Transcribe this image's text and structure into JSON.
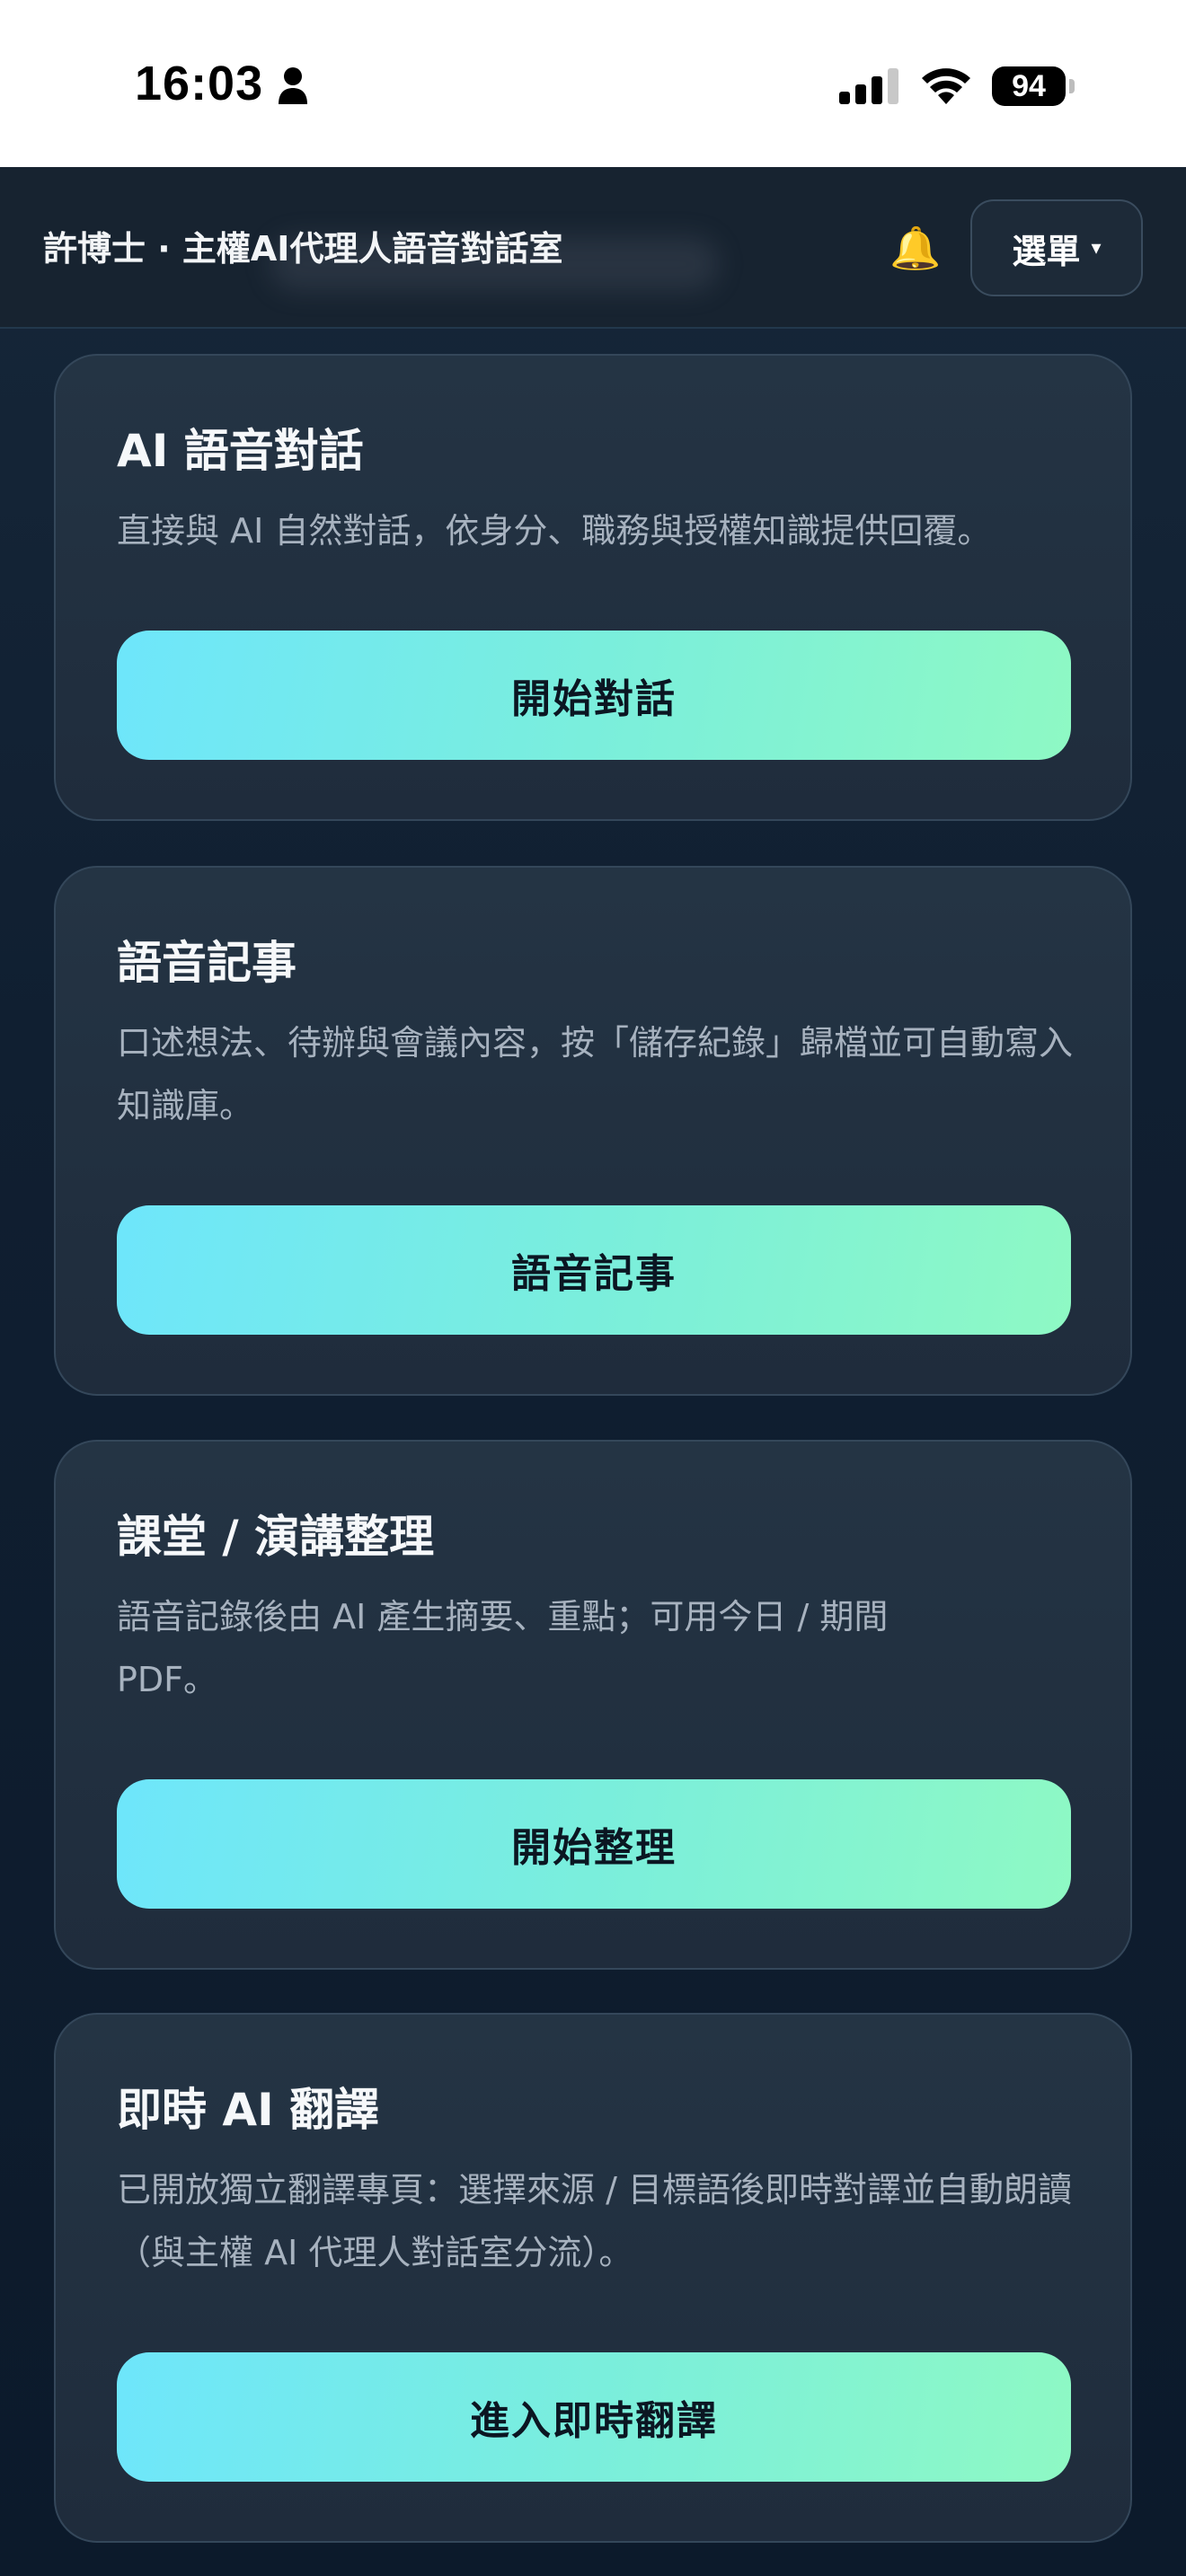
{
  "status_bar": {
    "time": "16:03",
    "battery": "94"
  },
  "header": {
    "title": "許博士 · 主權AI代理人語音對話室",
    "menu_label": "選單",
    "menu_caret": "▾"
  },
  "icons": {
    "bell": "🔔"
  },
  "cards": [
    {
      "title": "AI 語音對話",
      "description": "直接與 AI 自然對話，依身分、職務與授權知識提供回覆。",
      "button": "開始對話"
    },
    {
      "title": "語音記事",
      "description": "口述想法、待辦與會議內容，按「儲存紀錄」歸檔並可自動寫入知識庫。",
      "button": "語音記事"
    },
    {
      "title": "課堂 / 演講整理",
      "description": "語音記錄後由 AI 產生摘要、重點；可用今日 / 期間 PDF。",
      "button": "開始整理"
    },
    {
      "title": "即時 AI 翻譯",
      "description": "已開放獨立翻譯專頁：選擇來源 / 目標語後即時對譯並自動朗讀（與主權 AI 代理人對話室分流）。",
      "button": "進入即時翻譯"
    }
  ]
}
